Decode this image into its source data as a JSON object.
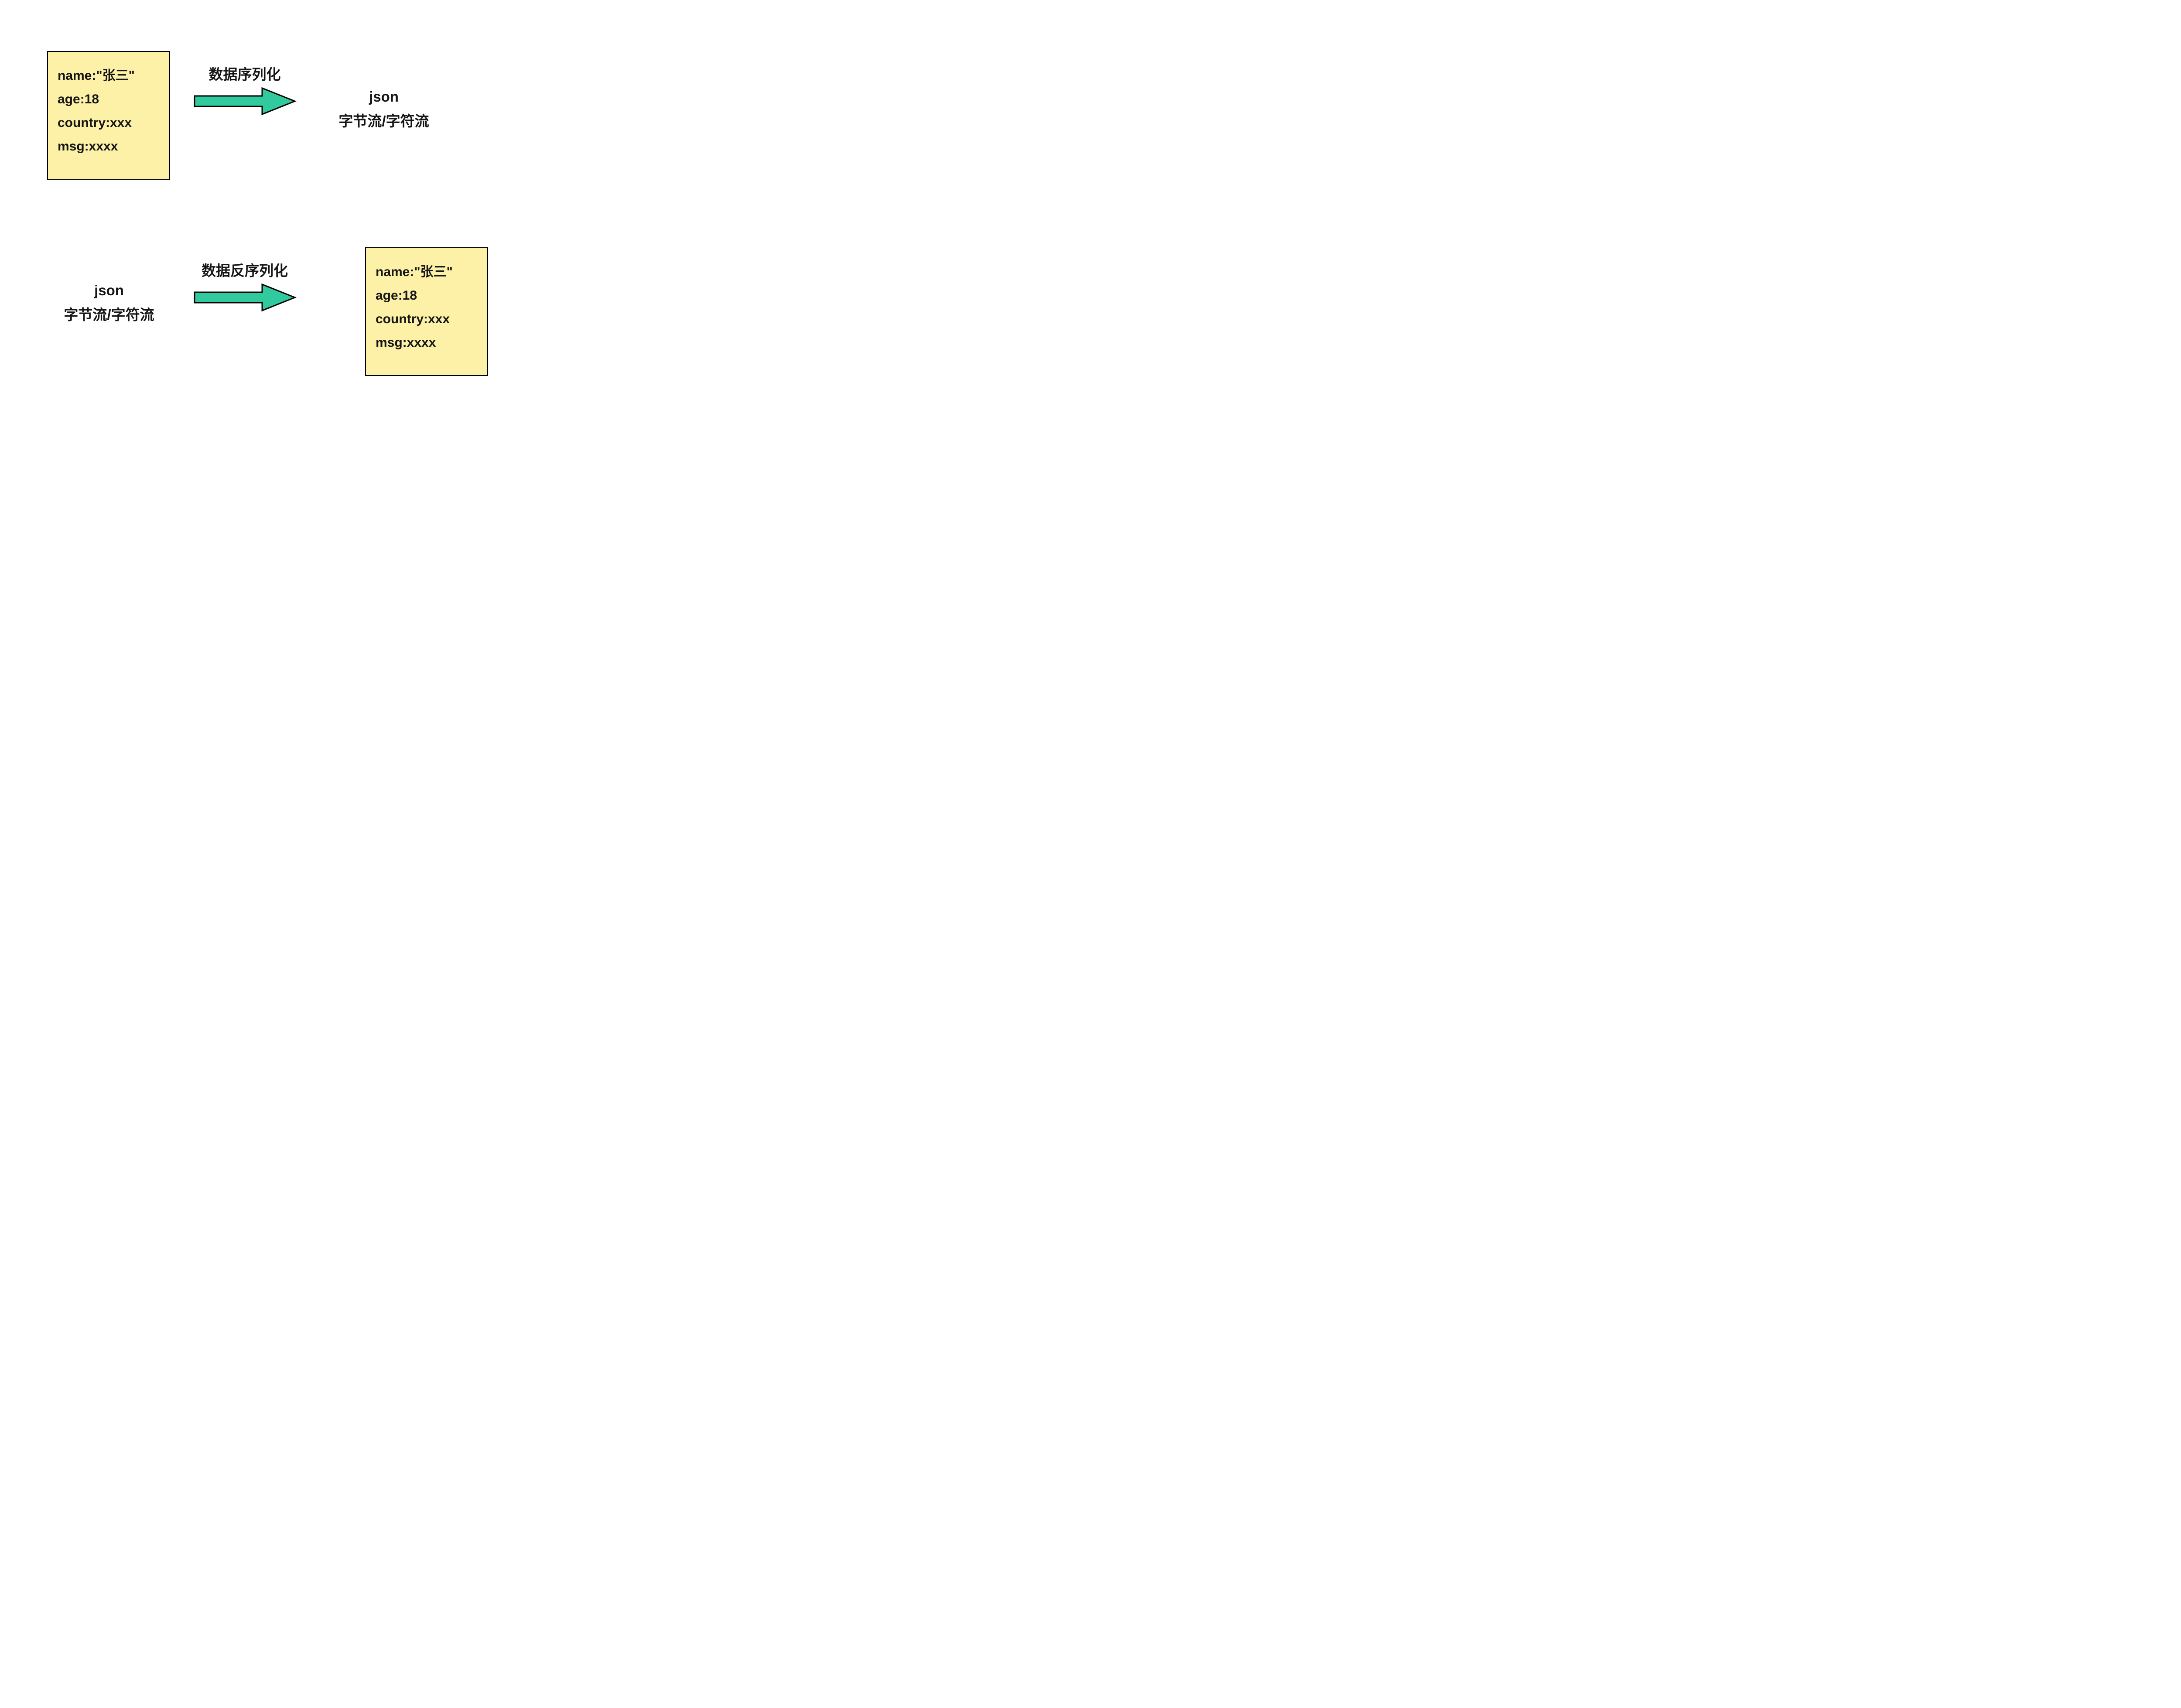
{
  "serialize": {
    "source": {
      "line1": "name:\"张三\"",
      "line2": "age:18",
      "line3": "country:xxx",
      "line4": "msg:xxxx"
    },
    "arrow_label": "数据序列化",
    "target": {
      "line1": "json",
      "line2": "字节流/字符流"
    }
  },
  "deserialize": {
    "source": {
      "line1": "json",
      "line2": "字节流/字符流"
    },
    "arrow_label": "数据反序列化",
    "target": {
      "line1": "name:\"张三\"",
      "line2": "age:18",
      "line3": "country:xxx",
      "line4": "msg:xxxx"
    }
  },
  "colors": {
    "box_fill": "#fcf1a6",
    "box_border": "#000000",
    "arrow_fill": "#31ca9f",
    "arrow_stroke": "#000000"
  }
}
